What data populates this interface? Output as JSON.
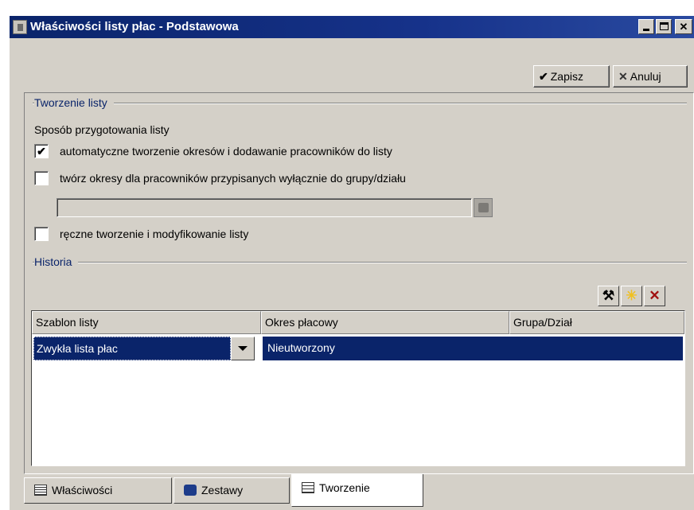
{
  "window": {
    "title": "Właściwości listy płac - Podstawowa",
    "controls": [
      "minimize-icon",
      "maximize-icon",
      "close-icon"
    ]
  },
  "toolbar": {
    "save_label": "Zapisz",
    "save_icon": "✔",
    "cancel_label": "Anuluj",
    "cancel_icon": "✕"
  },
  "creation": {
    "group_title": "Tworzenie listy",
    "method_label": "Sposób przygotowania listy",
    "options": [
      {
        "label": "automatyczne tworzenie okresów i dodawanie pracowników do listy",
        "checked": true,
        "mark": "✔"
      },
      {
        "label": "twórz okresy dla pracowników przypisanych wyłącznie do grupy/działu",
        "checked": false,
        "mark": ""
      },
      {
        "label": "ręczne tworzenie i modyfikowanie listy",
        "checked": false,
        "mark": ""
      }
    ],
    "group_field_value": ""
  },
  "history": {
    "group_title": "Historia",
    "tools": {
      "edit_icon": "⚒",
      "add_icon": "✳",
      "delete_icon": "✕"
    },
    "columns": [
      "Szablon listy",
      "Okres płacowy",
      "Grupa/Dział"
    ],
    "rows": [
      {
        "template": "Zwykła lista płac",
        "period": "Nieutworzony",
        "group": ""
      }
    ]
  },
  "tabs": [
    {
      "label": "Właściwości",
      "active": false
    },
    {
      "label": "Zestawy",
      "active": false
    },
    {
      "label": "Tworzenie",
      "active": true
    }
  ],
  "colors": {
    "title_bar": "#0a246a",
    "face": "#d4d0c8",
    "selection": "#0a246a",
    "group_label": "#0a246a"
  }
}
